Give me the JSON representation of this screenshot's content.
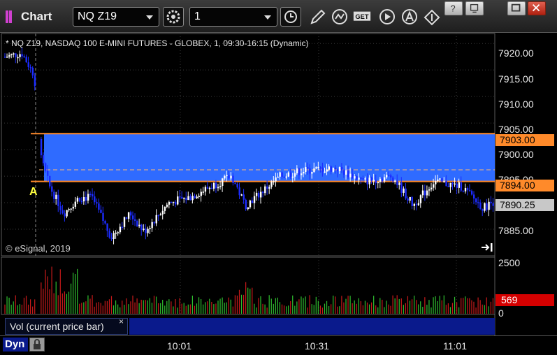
{
  "window": {
    "title": "Chart",
    "symbol_dropdown": "NQ Z19",
    "interval_dropdown": "1"
  },
  "toolbar_icons": [
    "settings-icon",
    "clock-icon",
    "pencil-icon",
    "studies-icon",
    "get-icon",
    "play-icon",
    "alert-icon",
    "cursor-icon"
  ],
  "window_controls": [
    "help-icon",
    "restore-icon",
    "maximize-icon",
    "close-icon"
  ],
  "chart": {
    "header": "* NQ Z19, NASDAQ 100 E-MINI FUTURES - GLOBEX, 1, 09:30-16:15 (Dynamic)",
    "copyright": "© eSignal, 2019",
    "alert_marker": "A",
    "price_ticks": [
      "7920.00",
      "7915.00",
      "7910.00",
      "7905.00",
      "7900.00",
      "7895.00",
      "7885.00"
    ],
    "upper_level": "7903.00",
    "lower_level": "7894.00",
    "last_price": "7890.25",
    "zone_color": "#2f6bff",
    "level_color": "#ff8a2a",
    "up_color": "#ffffff",
    "down_color": "#1c2cff",
    "y_range": [
      7880,
      7922
    ]
  },
  "volume": {
    "label": "Vol (current price bar)",
    "close_glyph": "×",
    "ticks": [
      "2500",
      "0"
    ],
    "current": "569",
    "up_color": "#2fbf2f",
    "down_color": "#c81a1a"
  },
  "time_axis": {
    "dyn_label": "Dyn",
    "labels": [
      "10:01",
      "10:31",
      "11:01"
    ]
  }
}
